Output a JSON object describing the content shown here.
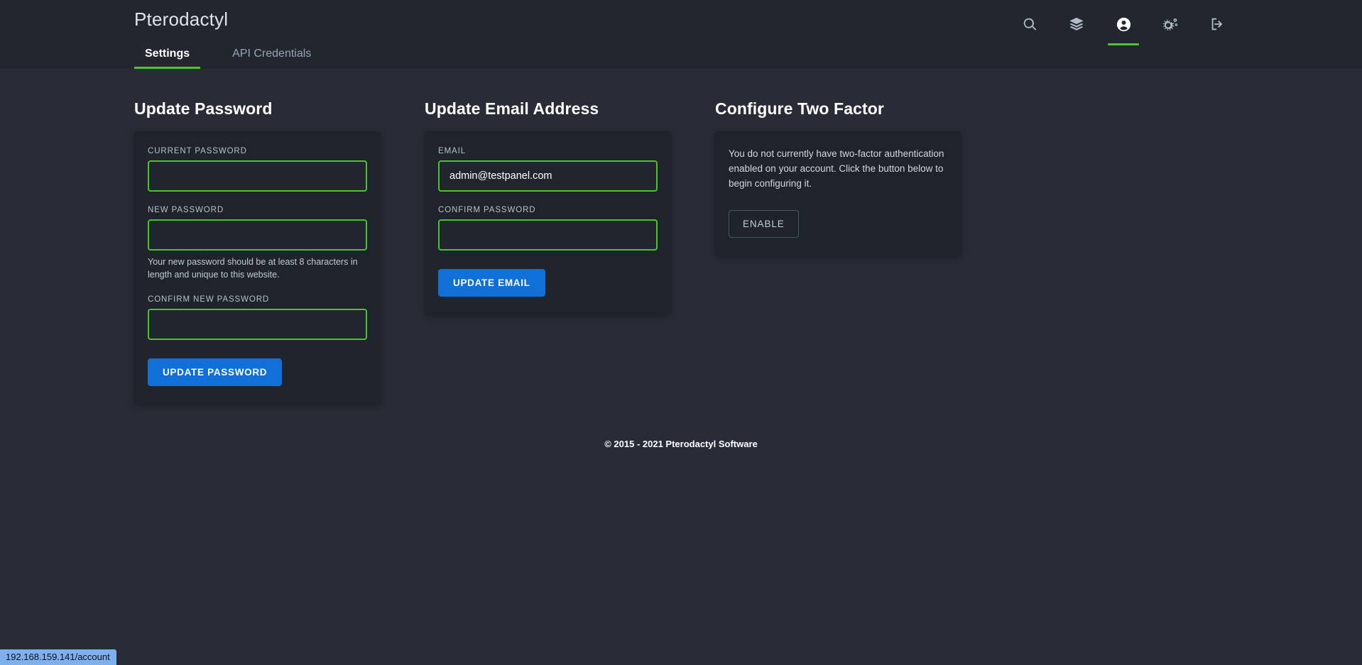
{
  "header": {
    "brand": "Pterodactyl",
    "tabs": [
      {
        "label": "Settings",
        "active": true
      },
      {
        "label": "API Credentials",
        "active": false
      }
    ],
    "nav_icons": [
      {
        "name": "search-icon",
        "active": false
      },
      {
        "name": "servers-layers-icon",
        "active": false
      },
      {
        "name": "account-user-icon",
        "active": true
      },
      {
        "name": "admin-cogs-icon",
        "active": false
      },
      {
        "name": "logout-icon",
        "active": false
      }
    ]
  },
  "colors": {
    "accent_green": "#50c42c",
    "input_border_green": "#4ac528",
    "primary_blue": "#1070d8",
    "header_bg": "#22262f",
    "page_bg": "#282c36",
    "card_bg": "#1f232c"
  },
  "update_password": {
    "title": "Update Password",
    "current_password_label": "Current Password",
    "current_password_value": "",
    "new_password_label": "New Password",
    "new_password_value": "",
    "new_password_help": "Your new password should be at least 8 characters in length and unique to this website.",
    "confirm_new_password_label": "Confirm New Password",
    "confirm_new_password_value": "",
    "submit_label": "Update Password"
  },
  "update_email": {
    "title": "Update Email Address",
    "email_label": "Email",
    "email_value": "admin@testpanel.com",
    "confirm_password_label": "Confirm Password",
    "confirm_password_value": "",
    "submit_label": "Update Email"
  },
  "two_factor": {
    "title": "Configure Two Factor",
    "description": "You do not currently have two-factor authentication enabled on your account. Click the button below to begin configuring it.",
    "enable_label": "Enable"
  },
  "footer": {
    "copyright": "© 2015 - 2021 Pterodactyl Software"
  },
  "status_bar": {
    "url": "192.168.159.141/account"
  }
}
